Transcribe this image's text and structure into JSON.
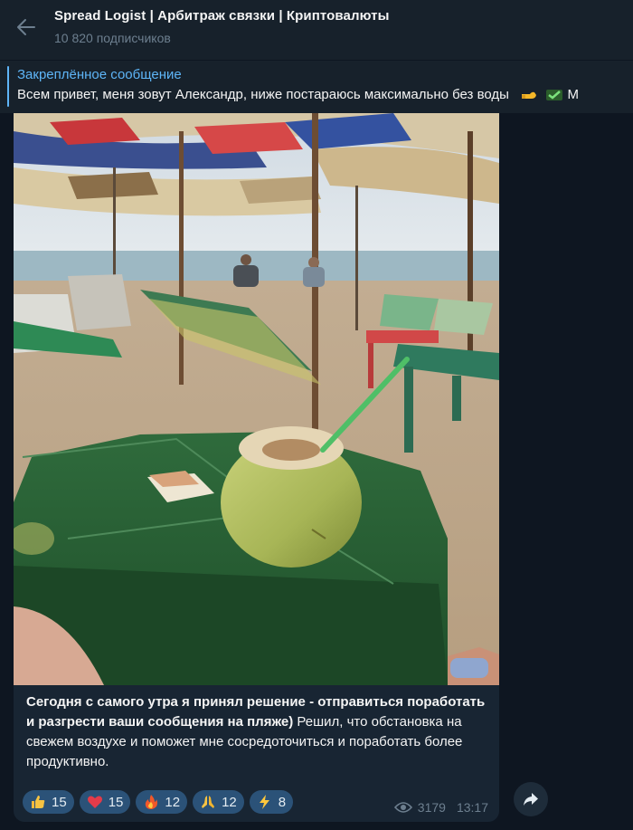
{
  "header": {
    "title": "Spread Logist | Арбитраж связки | Криптовалюты",
    "subscribers": "10 820 подписчиков",
    "back_icon": "arrow-left-icon"
  },
  "pinned": {
    "title": "Закреплённое сообщение",
    "text": "Всем привет, меня зовут Александр, ниже постараюсь максимально без воды",
    "trailing": "М"
  },
  "message": {
    "image_icon": "beach-photo",
    "caption_bold": "Сегодня с самого утра я принял  решение - отправиться поработать и разгрести ваши сообщения на пляже)",
    "caption_rest": " Решил, что обстановка на свежем воздухе и поможет мне сосредоточиться и поработать более продуктивно.",
    "reactions": [
      {
        "icon": "thumbs-up-icon",
        "count": "15"
      },
      {
        "icon": "heart-icon",
        "count": "15"
      },
      {
        "icon": "fire-icon",
        "count": "12"
      },
      {
        "icon": "pray-icon",
        "count": "12"
      },
      {
        "icon": "lightning-icon",
        "count": "8"
      }
    ],
    "views": "3179",
    "time": "13:17"
  },
  "colors": {
    "background": "#0e1621",
    "header": "#17212b",
    "accent": "#5eb5f7",
    "bubble": "#182533",
    "reaction": "#2b5278"
  }
}
